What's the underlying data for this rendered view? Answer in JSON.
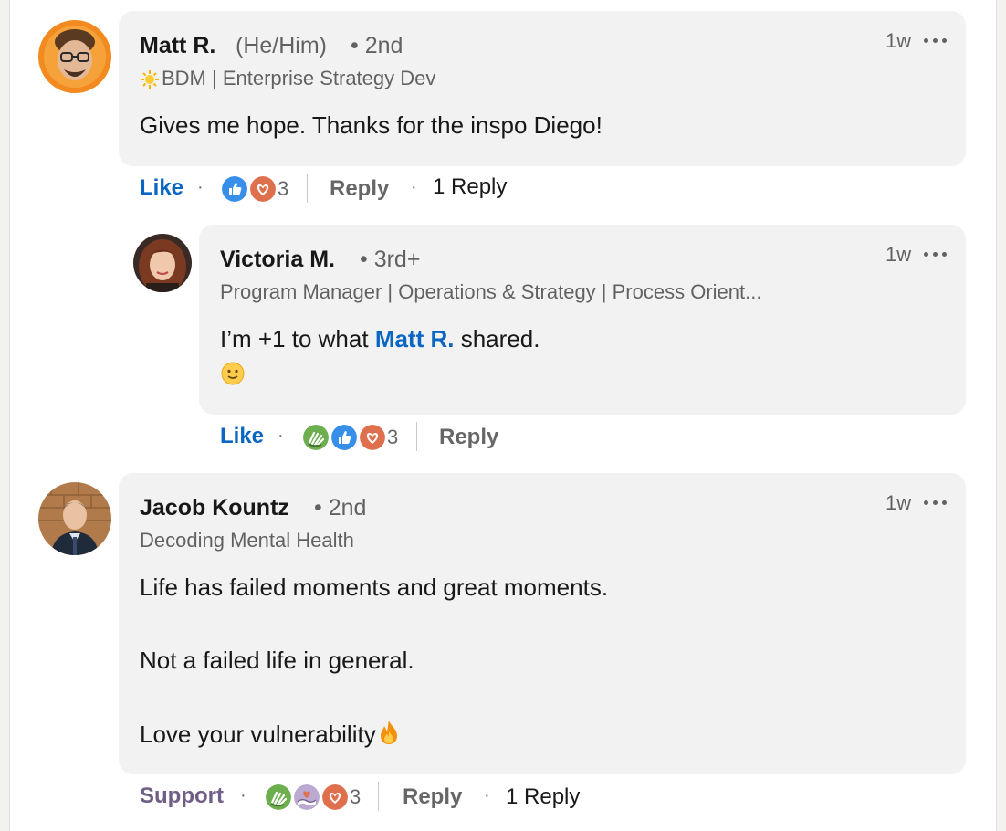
{
  "comments": [
    {
      "author": "Matt R.",
      "pronouns": "(He/Him)",
      "degree": "• 2nd",
      "headline_icon": "sun-icon",
      "headline": "BDM | Enterprise Strategy Dev",
      "time": "1w",
      "text": "Gives me hope. Thanks for the inspo Diego!",
      "action_label": "Like",
      "reactions": [
        "like-reaction",
        "love-reaction"
      ],
      "reaction_count": "3",
      "reply_label": "Reply",
      "replies_label": "1 Reply",
      "reply": {
        "author": "Victoria M.",
        "degree": "• 3rd+",
        "headline": "Program Manager | Operations & Strategy | Process Orient...",
        "time": "1w",
        "text_before": "I’m +1 to what ",
        "mention": "Matt R.",
        "text_after": " shared.",
        "emoji": "slightly-smiling-face",
        "action_label": "Like",
        "reactions": [
          "celebrate-reaction",
          "like-reaction",
          "love-reaction"
        ],
        "reaction_count": "3",
        "reply_label": "Reply"
      }
    },
    {
      "author": "Jacob Kountz",
      "degree": "• 2nd",
      "headline": "Decoding Mental Health",
      "time": "1w",
      "lines": [
        "Life has failed moments and great moments.",
        "Not a failed life in general.",
        "Love your vulnerability"
      ],
      "trailing_emoji": "fire",
      "action_label": "Support",
      "reactions": [
        "celebrate-reaction",
        "support-reaction",
        "love-reaction"
      ],
      "reaction_count": "3",
      "reply_label": "Reply",
      "replies_label": "1 Reply"
    }
  ],
  "colors": {
    "like": "#0a66c2",
    "support": "#715e86",
    "love": "#df704d",
    "celebrate": "#44712e",
    "bubble": "#f2f2f2"
  }
}
